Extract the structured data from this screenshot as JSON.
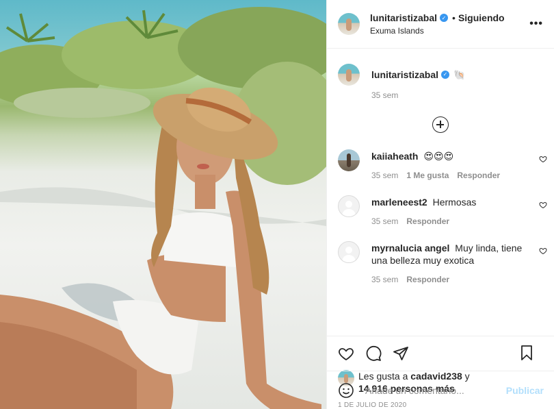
{
  "photo": {
    "alt_icon": "beach-photo",
    "accent": "#5fb9c9"
  },
  "header": {
    "username": "lunitaristizabal",
    "verified_icon": "verified-badge-icon",
    "separator": "•",
    "follow_label": "Siguiendo",
    "location": "Exuma Islands",
    "more_label": "•••"
  },
  "caption": {
    "username": "lunitaristizabal",
    "text": "🐚",
    "time": "35 sem"
  },
  "load_more_icon": "plus-circle-icon",
  "comments": [
    {
      "username": "kaiiaheath",
      "text": "😍😍😍",
      "time": "35 sem",
      "likes": "1 Me gusta",
      "reply": "Responder"
    },
    {
      "username": "marleneest2",
      "text": "Hermosas",
      "time": "35 sem",
      "likes": "",
      "reply": "Responder"
    },
    {
      "username": "myrnalucia angel",
      "text": "Muy linda, tiene una belleza muy exotica",
      "time": "35 sem",
      "likes": "",
      "reply": "Responder"
    }
  ],
  "likes": {
    "prefix": "Les gusta a ",
    "user": "cadavid238",
    "mid": " y",
    "count": "14.916 personas más"
  },
  "date": "1 DE JULIO DE 2020",
  "comment_box": {
    "placeholder": "Añade un comentario...",
    "publish_label": "Publicar"
  },
  "colors": {
    "verified": "#3897f0",
    "muted": "#8e8e8e",
    "publish_disabled": "#b2dffc"
  }
}
